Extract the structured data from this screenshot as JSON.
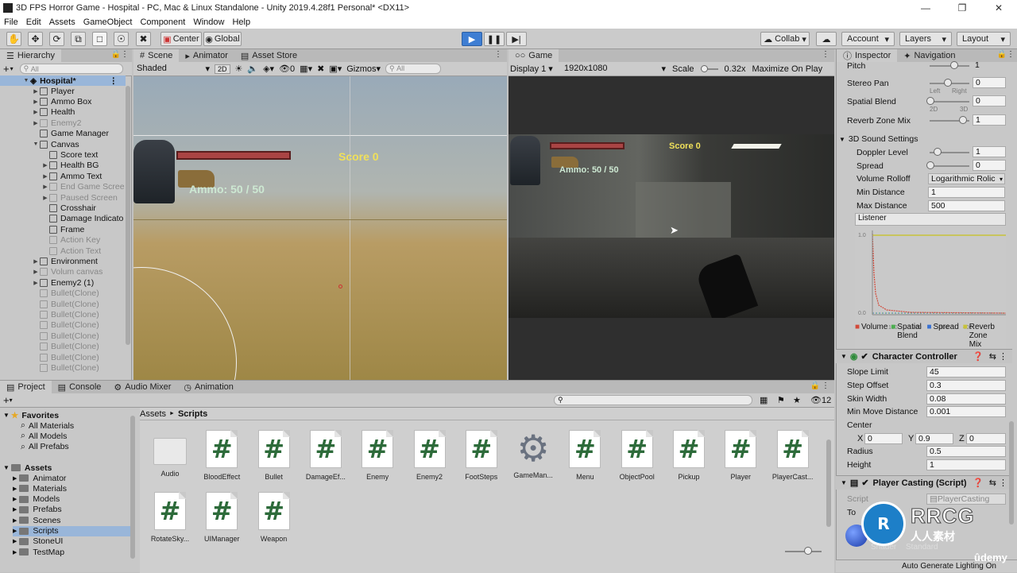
{
  "window": {
    "title": "3D FPS Horror Game - Hospital - PC, Mac & Linux Standalone - Unity 2019.4.28f1 Personal* <DX11>"
  },
  "menu": [
    "File",
    "Edit",
    "Assets",
    "GameObject",
    "Component",
    "Window",
    "Help"
  ],
  "toolbar": {
    "center": "Center",
    "global": "Global",
    "collab": "Collab",
    "account": "Account",
    "layers": "Layers",
    "layout": "Layout"
  },
  "hierarchy": {
    "tab": "Hierarchy",
    "search_placeholder": "All",
    "scene": "Hospital*",
    "items": [
      {
        "label": "Player",
        "depth": 1,
        "dim": false,
        "arrow": true
      },
      {
        "label": "Ammo Box",
        "depth": 1,
        "dim": false,
        "arrow": true
      },
      {
        "label": "Health",
        "depth": 1,
        "dim": false,
        "arrow": true
      },
      {
        "label": "Enemy2",
        "depth": 1,
        "dim": true,
        "arrow": true
      },
      {
        "label": "Game Manager",
        "depth": 1,
        "dim": false,
        "arrow": false
      },
      {
        "label": "Canvas",
        "depth": 1,
        "dim": false,
        "arrow": true,
        "open": true
      },
      {
        "label": "Score text",
        "depth": 2,
        "dim": false,
        "arrow": false
      },
      {
        "label": "Health BG",
        "depth": 2,
        "dim": false,
        "arrow": true
      },
      {
        "label": "Ammo  Text",
        "depth": 2,
        "dim": false,
        "arrow": true
      },
      {
        "label": "End Game Scree",
        "depth": 2,
        "dim": true,
        "arrow": true
      },
      {
        "label": "Paused Screen",
        "depth": 2,
        "dim": true,
        "arrow": true
      },
      {
        "label": "Crosshair",
        "depth": 2,
        "dim": false,
        "arrow": false
      },
      {
        "label": "Damage Indicato",
        "depth": 2,
        "dim": false,
        "arrow": false
      },
      {
        "label": "Frame",
        "depth": 2,
        "dim": false,
        "arrow": false
      },
      {
        "label": "Action Key",
        "depth": 2,
        "dim": true,
        "arrow": false
      },
      {
        "label": "Action Text",
        "depth": 2,
        "dim": true,
        "arrow": false
      },
      {
        "label": "Environment",
        "depth": 1,
        "dim": false,
        "arrow": true
      },
      {
        "label": "Volum canvas",
        "depth": 1,
        "dim": true,
        "arrow": true
      },
      {
        "label": "Enemy2 (1)",
        "depth": 1,
        "dim": false,
        "arrow": true
      },
      {
        "label": "Bullet(Clone)",
        "depth": 1,
        "dim": true,
        "arrow": false
      },
      {
        "label": "Bullet(Clone)",
        "depth": 1,
        "dim": true,
        "arrow": false
      },
      {
        "label": "Bullet(Clone)",
        "depth": 1,
        "dim": true,
        "arrow": false
      },
      {
        "label": "Bullet(Clone)",
        "depth": 1,
        "dim": true,
        "arrow": false
      },
      {
        "label": "Bullet(Clone)",
        "depth": 1,
        "dim": true,
        "arrow": false
      },
      {
        "label": "Bullet(Clone)",
        "depth": 1,
        "dim": true,
        "arrow": false
      },
      {
        "label": "Bullet(Clone)",
        "depth": 1,
        "dim": true,
        "arrow": false
      },
      {
        "label": "Bullet(Clone)",
        "depth": 1,
        "dim": true,
        "arrow": false
      }
    ]
  },
  "scene_tabs": {
    "scene": "Scene",
    "animator": "Animator",
    "asset_store": "Asset Store",
    "shading": "Shaded",
    "mode_2d": "2D",
    "gizmos": "Gizmos",
    "search": "All",
    "hidden_count": "0"
  },
  "game_tab": {
    "tab": "Game",
    "display": "Display 1",
    "resolution": "1920x1080",
    "scale_label": "Scale",
    "scale_value": "0.32x",
    "maximize": "Maximize On Play"
  },
  "hud": {
    "score": "Score 0",
    "ammo": "Ammo: 50 / 50"
  },
  "inspector": {
    "tab": "Inspector",
    "nav_tab": "Navigation",
    "pitch_label": "Pitch",
    "pitch_value": "1",
    "stereo_pan_label": "Stereo Pan",
    "stereo_pan_value": "0",
    "stereo_left": "Left",
    "stereo_right": "Right",
    "spatial_blend_label": "Spatial Blend",
    "spatial_blend_value": "0",
    "blend_2d": "2D",
    "blend_3d": "3D",
    "reverb_label": "Reverb Zone Mix",
    "reverb_value": "1",
    "sound_settings": "3D Sound Settings",
    "doppler_label": "Doppler Level",
    "doppler_value": "1",
    "spread_label": "Spread",
    "spread_value": "0",
    "rolloff_label": "Volume Rolloff",
    "rolloff_value": "Logarithmic Rolic",
    "min_dist_label": "Min Distance",
    "min_dist_value": "1",
    "max_dist_label": "Max Distance",
    "max_dist_value": "500",
    "listener": "Listener",
    "graph_ticks": [
      "1.0",
      "0.0",
      "100",
      "200",
      "300",
      "400"
    ],
    "graph_legend": [
      "Volume",
      "Spatial Blend",
      "Spread",
      "Reverb Zone Mix"
    ],
    "graph_legend_colors": [
      "#d24a3a",
      "#4caf50",
      "#3a72d2",
      "#c7c23a"
    ],
    "cc_title": "Character Controller",
    "slope_label": "Slope Limit",
    "slope_value": "45",
    "step_label": "Step Offset",
    "step_value": "0.3",
    "skin_label": "Skin Width",
    "skin_value": "0.08",
    "minmove_label": "Min Move Distance",
    "minmove_value": "0.001",
    "center_label": "Center",
    "cx_label": "X",
    "cx_value": "0",
    "cy_label": "Y",
    "cy_value": "0.9",
    "cz_label": "Z",
    "cz_value": "0",
    "radius_label": "Radius",
    "radius_value": "0.5",
    "height_label": "Height",
    "height_value": "1",
    "pc_title": "Player Casting (Script)",
    "script_label": "Script",
    "script_value": "PlayerCasting",
    "to_label": "To",
    "shader_label": "Shader",
    "shader_value": "Standard",
    "status": "Auto Generate Lighting On"
  },
  "project": {
    "tabs": [
      "Project",
      "Console",
      "Audio Mixer",
      "Animation"
    ],
    "breadcrumb_root": "Assets",
    "breadcrumb_sep": "►",
    "breadcrumb_leaf": "Scripts",
    "hidden_count": "12",
    "favorites": "Favorites",
    "fav_items": [
      "All Materials",
      "All Models",
      "All Prefabs"
    ],
    "assets": "Assets",
    "folders": [
      "Animator",
      "Materials",
      "Models",
      "Prefabs",
      "Scenes",
      "Scripts",
      "StoneUI",
      "TestMap"
    ],
    "files": [
      {
        "label": "Audio",
        "kind": "folder"
      },
      {
        "label": "BloodEffect",
        "kind": "script"
      },
      {
        "label": "Bullet",
        "kind": "script"
      },
      {
        "label": "DamageEf...",
        "kind": "script"
      },
      {
        "label": "Enemy",
        "kind": "script"
      },
      {
        "label": "Enemy2",
        "kind": "script"
      },
      {
        "label": "FootSteps",
        "kind": "script"
      },
      {
        "label": "GameMan...",
        "kind": "gear"
      },
      {
        "label": "Menu",
        "kind": "script"
      },
      {
        "label": "ObjectPool",
        "kind": "script"
      },
      {
        "label": "Pickup",
        "kind": "script"
      },
      {
        "label": "Player",
        "kind": "script"
      },
      {
        "label": "PlayerCast...",
        "kind": "script"
      },
      {
        "label": "RotateSky...",
        "kind": "script"
      },
      {
        "label": "UIManager",
        "kind": "script"
      },
      {
        "label": "Weapon",
        "kind": "script"
      }
    ]
  },
  "watermark": {
    "brand": "RRCG",
    "cn": "人人素材",
    "udemy": "ûdemy"
  }
}
